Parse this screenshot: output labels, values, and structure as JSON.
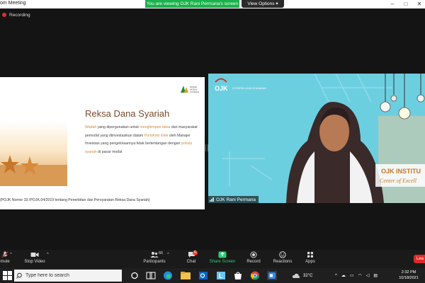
{
  "window": {
    "title": "om Meeting"
  },
  "share_banner": {
    "text": "You are viewing OJK Rani Permana's screen"
  },
  "view_options": {
    "label": "View Options",
    "caret": "▾"
  },
  "recording": {
    "label": "Recording"
  },
  "slide": {
    "title": "Reksa Dana Syariah",
    "body_parts": [
      {
        "text": "Wadah",
        "hl": true
      },
      {
        "text": " yang dipergunakan untuk ",
        "hl": false
      },
      {
        "text": "menghimpun dana",
        "hl": true
      },
      {
        "text": " dari masyarakat pemodal yang diinvestasikan dalam ",
        "hl": false
      },
      {
        "text": "Portofolio Efek",
        "hl": true
      },
      {
        "text": " oleh Manajer Investasi yang pengelolaannya tidak bertentangan dengan ",
        "hl": false
      },
      {
        "text": "prinsip syariah",
        "hl": true
      },
      {
        "text": " di pasar modal",
        "hl": false
      }
    ],
    "footnote": "(POJK Nomor 33 /POJK.04/2019 tentang Penerbitan dan Persyaratan Reksa Dana Syariah)",
    "logo_text": "PASAR MODAL SYARIAH"
  },
  "video": {
    "participant_name": "OJK Rani Permana",
    "ojk_logo": "OJK",
    "ojk_tagline": "OTORITAS JASA KEUANGAN",
    "bg_text_1": "OJK INSTITU",
    "bg_text_2": "Center of Excell"
  },
  "toolbar": {
    "mute": "mute",
    "stop_video": "Stop Video",
    "participants": "Participants",
    "participants_count": "66",
    "chat": "Chat",
    "chat_badge": "6",
    "share_screen": "Share Screen",
    "record": "Record",
    "reactions": "Reactions",
    "apps": "Apps",
    "leave": "Lea"
  },
  "taskbar": {
    "search_placeholder": "Type here to search",
    "weather": "32°C",
    "time": "2:32 PM",
    "date": "10/18/2021"
  },
  "colors": {
    "accent_green": "#19b24b",
    "leave_red": "#e02828",
    "slide_title": "#7a4a2a",
    "highlight": "#d08a3a",
    "video_bg": "#6ccfe0"
  }
}
